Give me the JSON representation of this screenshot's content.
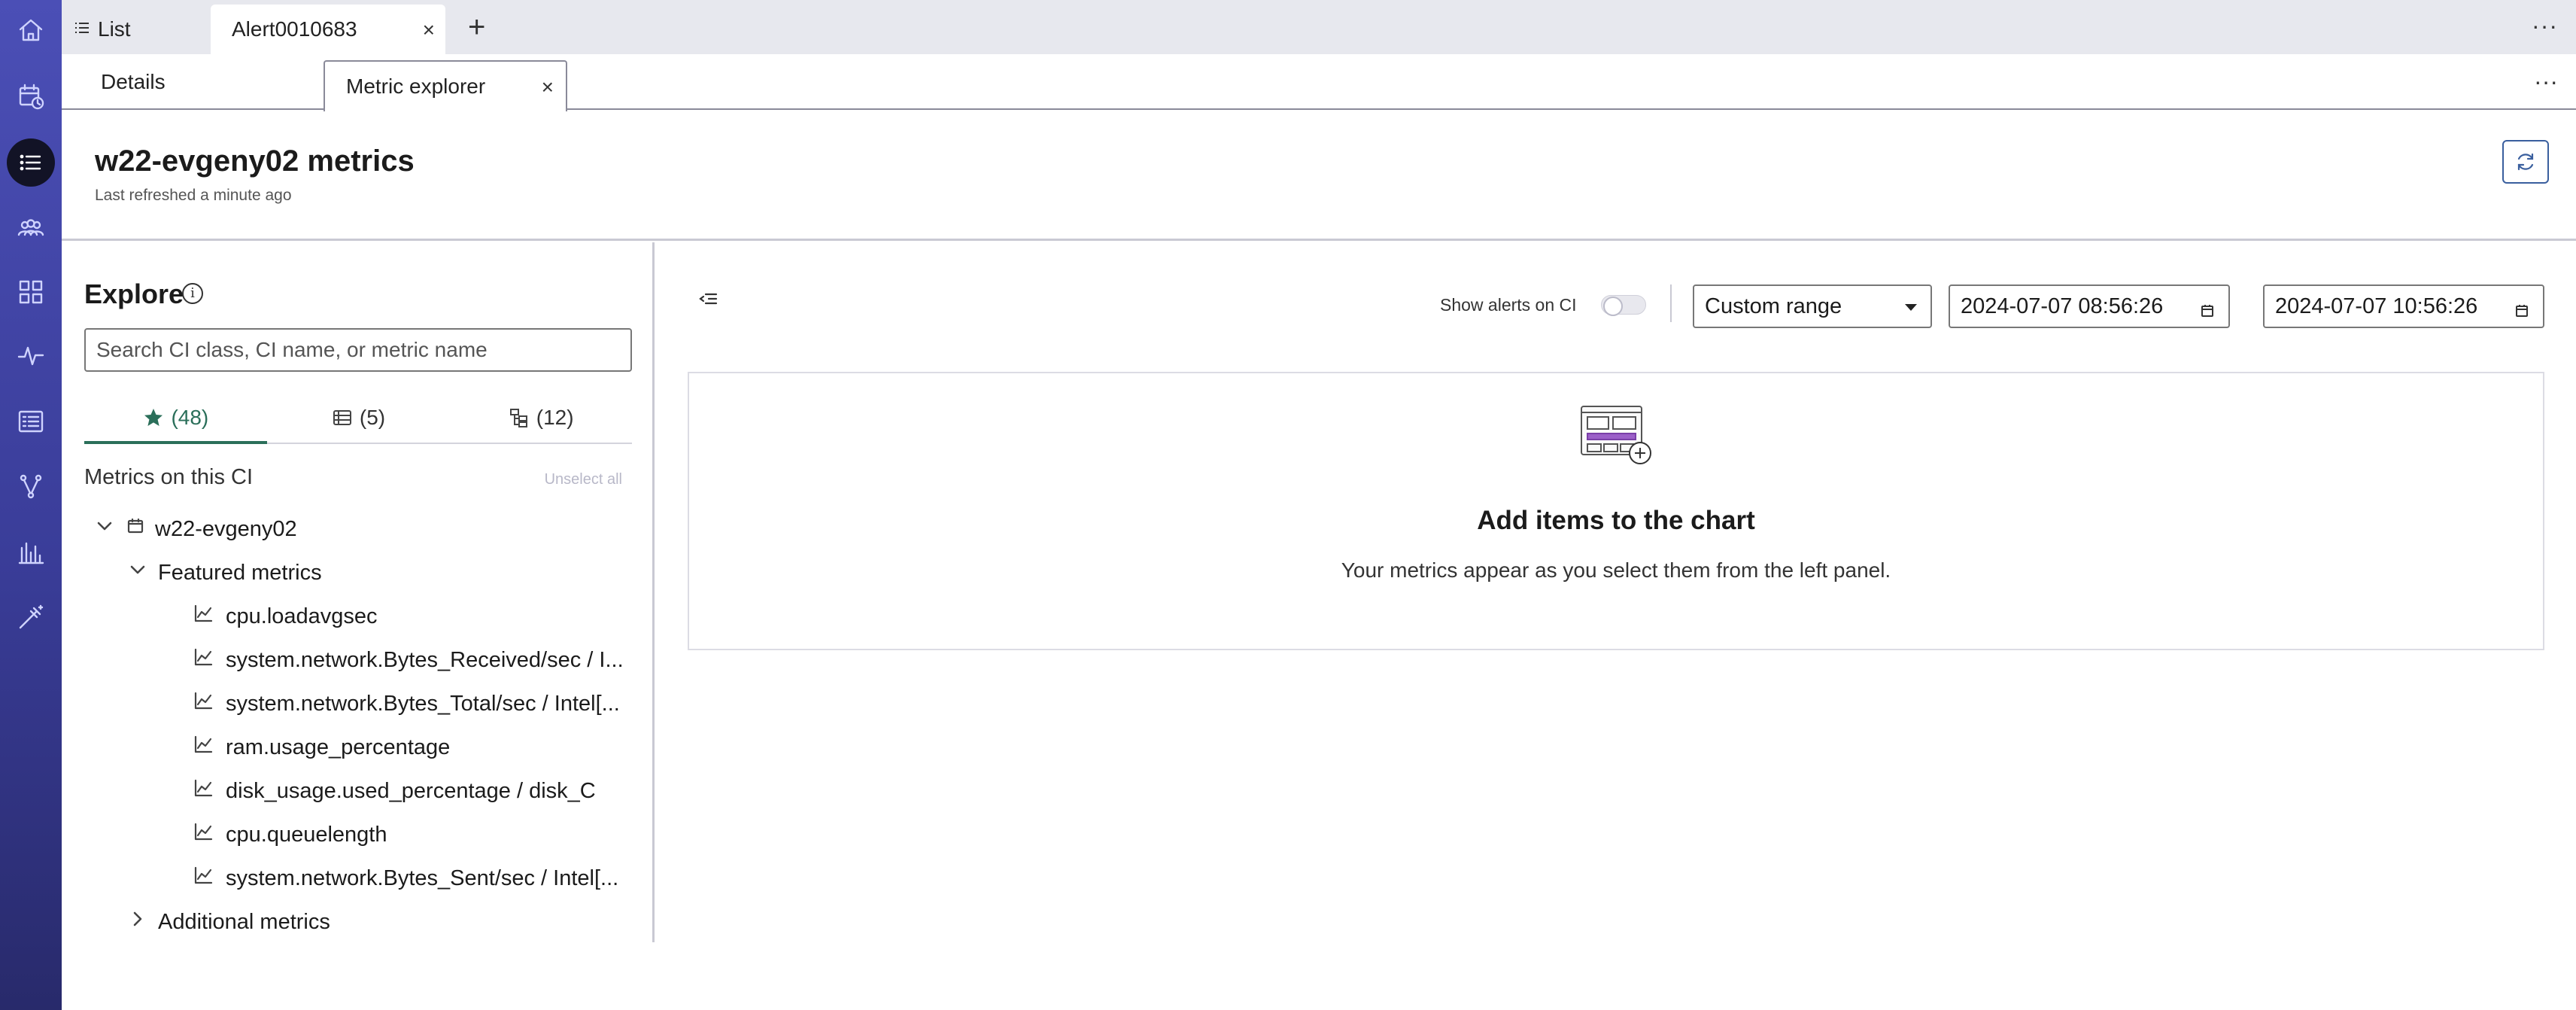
{
  "top_tabs": {
    "list_label": "List",
    "alert_label": "Alert0010683",
    "close_glyph": "×",
    "add_glyph": "+",
    "more_glyph": "···"
  },
  "sub_tabs": {
    "details_label": "Details",
    "metric_label": "Metric explorer",
    "close_glyph": "×",
    "more_glyph": "···"
  },
  "page": {
    "title": "w22-evgeny02 metrics",
    "subtitle": "Last refreshed a minute ago"
  },
  "explore": {
    "title": "Explore",
    "search_placeholder": "Search CI class, CI name, or metric name",
    "tabs": [
      {
        "label": "(48)",
        "icon": "star-icon"
      },
      {
        "label": "(5)",
        "icon": "database-icon"
      },
      {
        "label": "(12)",
        "icon": "hierarchy-icon"
      }
    ],
    "metrics_heading": "Metrics on this CI",
    "unselect_all": "Unselect all",
    "ci_name": "w22-evgeny02",
    "featured_label": "Featured metrics",
    "featured_metrics": [
      "cpu.loadavgsec",
      "system.network.Bytes_Received/sec / I...",
      "system.network.Bytes_Total/sec / Intel[...",
      "ram.usage_percentage",
      "disk_usage.used_percentage / disk_C",
      "cpu.queuelength",
      "system.network.Bytes_Sent/sec / Intel[..."
    ],
    "additional_label": "Additional metrics"
  },
  "chart": {
    "show_alerts_label": "Show alerts on CI",
    "range_value": "Custom range",
    "from_value": "2024-07-07 08:56:26",
    "to_value": "2024-07-07 10:56:26",
    "empty_title": "Add items to the chart",
    "empty_subtitle": "Your metrics appear as you select them from the left panel."
  },
  "colors": {
    "rail_top": "#4b4fb6",
    "rail_bottom": "#282a6b",
    "accent_green": "#2b6f5a",
    "illustration_purple": "#9b5fc8"
  }
}
